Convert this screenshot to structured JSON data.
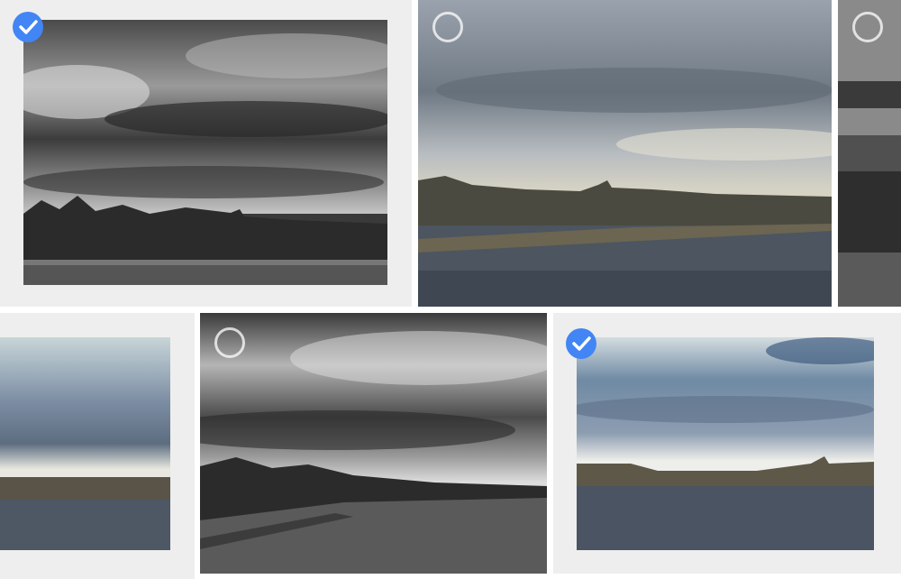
{
  "grid": {
    "photos": [
      {
        "style": "bw-stormy-river",
        "selected": true,
        "checkbox_icon": "check-circle-icon"
      },
      {
        "style": "color-castle-river",
        "selected": false,
        "checkbox_icon": "empty-circle-icon"
      },
      {
        "style": "bw-river-partial",
        "selected": false,
        "checkbox_icon": "empty-circle-icon"
      },
      {
        "style": "color-river-partial",
        "selected": false,
        "checkbox_icon": ""
      },
      {
        "style": "bw-dramatic-river",
        "selected": false,
        "checkbox_icon": "empty-circle-icon"
      },
      {
        "style": "color-bridge-river",
        "selected": true,
        "checkbox_icon": "check-circle-icon"
      }
    ]
  },
  "colors": {
    "accent": "#4285f4",
    "selected_tile_bg": "#eeeeee",
    "page_bg": "#ffffff"
  }
}
